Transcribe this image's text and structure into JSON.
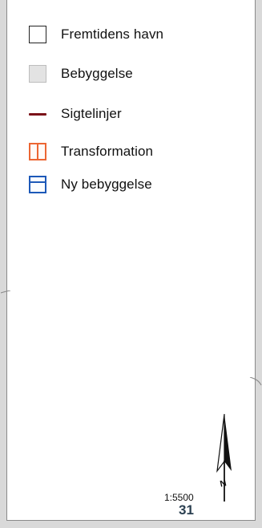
{
  "legend": {
    "items": [
      {
        "label": "Fremtidens havn",
        "icon": "outlined-square-icon",
        "color": "#222222"
      },
      {
        "label": "Bebyggelse",
        "icon": "gray-square-icon",
        "color": "#e3e3e3"
      },
      {
        "label": "Sigtelinjer",
        "icon": "sightline-icon",
        "color": "#7b1219"
      },
      {
        "label": "Transformation",
        "icon": "transformation-icon",
        "color": "#ec6633"
      },
      {
        "label": "Ny bebyggelse",
        "icon": "new-building-icon",
        "color": "#1d59b8"
      }
    ]
  },
  "map": {
    "scale": "1:5500",
    "north_label": "N",
    "north_icon": "north-arrow-icon",
    "page_number": "31"
  }
}
